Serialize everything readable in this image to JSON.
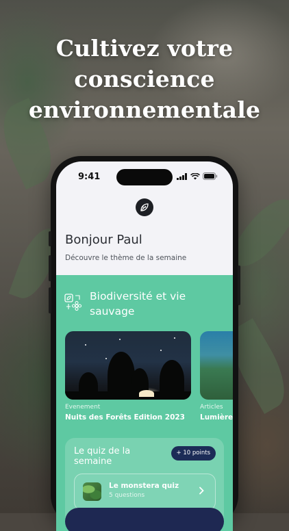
{
  "headline": {
    "line1": "Cultivez votre",
    "line2": "conscience",
    "line3": "environnementale"
  },
  "status_bar": {
    "time": "9:41"
  },
  "home": {
    "greeting": "Bonjour Paul",
    "subtitle": "Découvre le thème de la semaine"
  },
  "theme": {
    "title": "Biodiversité et vie sauvage",
    "icon": "biodiversity-icon"
  },
  "cards": [
    {
      "category": "Evenement",
      "title": "Nuits des Forêts Edition 2023"
    },
    {
      "category": "Articles",
      "title": "Lumière"
    }
  ],
  "quiz": {
    "title": "Le quiz de la semaine",
    "badge": "+ 10 points",
    "item_name": "Le monstera quiz",
    "item_count": "5 questions"
  },
  "colors": {
    "accent_green": "#5ec9a2",
    "navy": "#1e2852",
    "badge_bg": "#1c2c57"
  }
}
